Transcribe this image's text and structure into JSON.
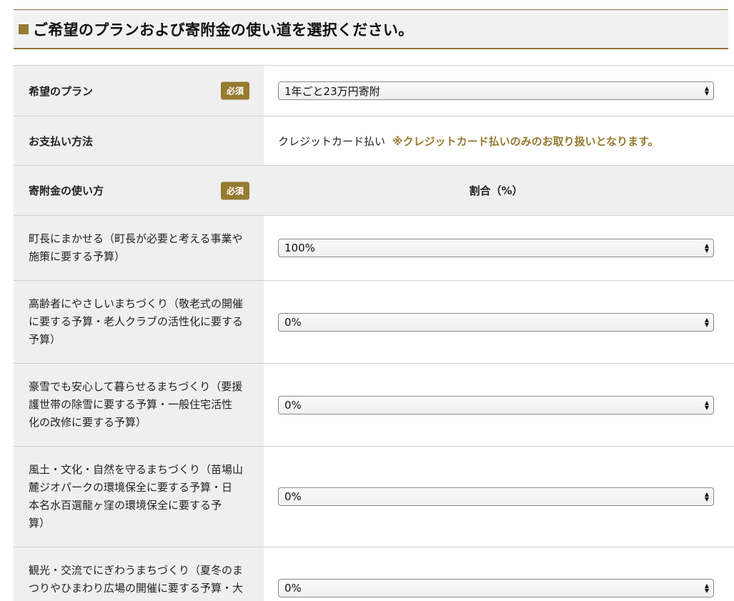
{
  "section": {
    "title": "ご希望のプランおよび寄附金の使い道を選択ください。"
  },
  "plan": {
    "label": "希望のプラン",
    "badge": "必須",
    "selected": "1年ごと23万円寄附"
  },
  "payment": {
    "label": "お支払い方法",
    "method": "クレジットカード払い",
    "note": "※クレジットカード払いのみのお取り扱いとなります。"
  },
  "usage": {
    "label": "寄附金の使い方",
    "badge": "必須",
    "pct_header": "割合（%）",
    "items": [
      {
        "label_lines": [
          "町長にまかせる（町長が必要と考える事業や",
          "施策に要する予算）"
        ],
        "value": "100%"
      },
      {
        "label_lines": [
          "高齢者にやさしいまちづくり（敬老式の開催",
          "に要する予算・老人クラブの活性化に要する",
          "予算）"
        ],
        "value": "0%"
      },
      {
        "label_lines": [
          "豪雪でも安心して暮らせるまちづくり（要援",
          "護世帯の除雪に要する予算・一般住宅活性",
          "化の改修に要する予算）"
        ],
        "value": "0%"
      },
      {
        "label_lines": [
          "風土・文化・自然を守るまちづくり（苗場山",
          "麓ジオパークの環境保全に要する予算・日",
          "本名水百選龍ヶ窪の環境保全に要する予",
          "算）"
        ],
        "value": "0%"
      },
      {
        "label_lines": [
          "観光・交流でにぎわうまちづくり（夏冬のま",
          "つりやひまわり広場の開催に要する予算・大"
        ],
        "value": "0%"
      }
    ]
  }
}
